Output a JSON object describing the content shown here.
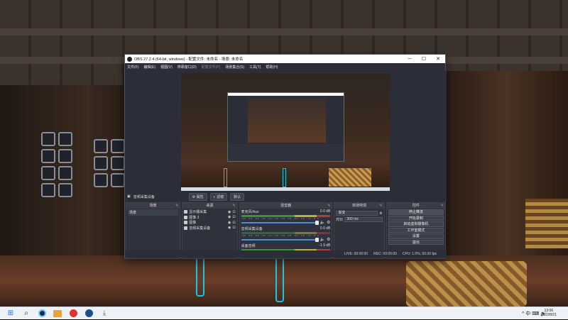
{
  "window": {
    "title": "OBS 27.2.4 (64-bit, windows) - 配置文件: 未命名 - 场景: 未命名",
    "minimize": "─",
    "maximize": "☐",
    "close": "✕"
  },
  "menu": [
    {
      "label": "文件(F)",
      "enabled": true
    },
    {
      "label": "编辑(E)",
      "enabled": true
    },
    {
      "label": "视图(V)",
      "enabled": true
    },
    {
      "label": "停靠窗口(D)",
      "enabled": true
    },
    {
      "label": "配置文件(P)",
      "enabled": false
    },
    {
      "label": "场景集合(S)",
      "enabled": true
    },
    {
      "label": "工具(T)",
      "enabled": true
    },
    {
      "label": "帮助(H)",
      "enabled": true
    }
  ],
  "source_toolbar": {
    "current_source": "音频采集设备",
    "properties": "属性",
    "filters": "滤镜",
    "default": "默认"
  },
  "docks": {
    "scenes": {
      "header": "场景",
      "items": [
        "场景"
      ]
    },
    "sources": {
      "header": "来源",
      "items": [
        {
          "name": "显示器采集",
          "icon": "monitor-icon"
        },
        {
          "name": "图像 3",
          "icon": "image-icon"
        },
        {
          "name": "图像",
          "icon": "image-icon"
        },
        {
          "name": "音频采集设备",
          "icon": "speaker-icon"
        }
      ]
    },
    "mixer": {
      "header": "混音器",
      "channels": [
        {
          "name": "麦克风/Aux",
          "level": "0.0 dB",
          "active": true
        },
        {
          "name": "音频采集设备",
          "level": "0.0 dB",
          "active": false
        },
        {
          "name": "桌面音频",
          "level": "-1.9 dB",
          "active": true
        }
      ],
      "ticks": "-60 -55 -50 -45 -40 -35 -30 -25 -20 -15 -10 -5 0"
    },
    "transitions": {
      "header": "转场特效",
      "selected": "渐变",
      "duration_label": "时长",
      "duration_value": "300 ms"
    },
    "controls": {
      "header": "控件",
      "buttons": [
        {
          "label": "停止推流",
          "active": true
        },
        {
          "label": "开始录制",
          "active": false
        },
        {
          "label": "启动虚拟摄像机",
          "active": false
        },
        {
          "label": "工作室模式",
          "active": false
        },
        {
          "label": "设置",
          "active": false
        },
        {
          "label": "退出",
          "active": false
        }
      ]
    }
  },
  "status": {
    "live": "LIVE: 00:00:00",
    "rec": "REC: 00:00:00",
    "cpu": "CPU: 1.0%, 60.00 fps"
  },
  "taskbar": {
    "apps": [
      "windows-logo",
      "search-icon",
      "obs-icon",
      "folder-icon",
      "red-app-icon",
      "steam-icon",
      "download-icon"
    ],
    "clock_time": "13:06",
    "clock_date": "2022/8/21",
    "tray": "^ 中 ⌨ 🔊"
  }
}
